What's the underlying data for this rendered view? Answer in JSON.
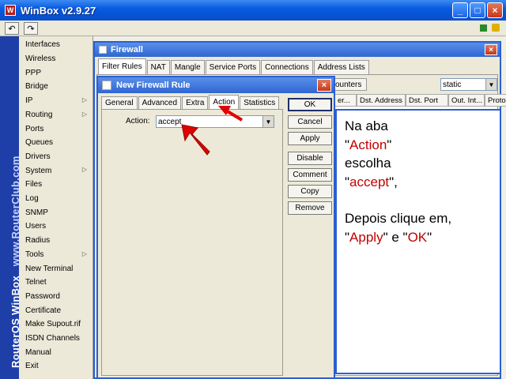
{
  "window": {
    "title": "WinBox v2.9.27",
    "icon_label": "W",
    "minimize": "_",
    "maximize": "□",
    "close": "×"
  },
  "toolbar": {
    "undo": "↶",
    "redo": "↷"
  },
  "brand": {
    "part1": "RouterOS WinBox",
    "part2": "www.RouterClub.com"
  },
  "menu": {
    "items": [
      {
        "label": "Interfaces",
        "arrow": ""
      },
      {
        "label": "Wireless",
        "arrow": ""
      },
      {
        "label": "PPP",
        "arrow": ""
      },
      {
        "label": "Bridge",
        "arrow": ""
      },
      {
        "label": "IP",
        "arrow": "▷"
      },
      {
        "label": "Routing",
        "arrow": "▷"
      },
      {
        "label": "Ports",
        "arrow": ""
      },
      {
        "label": "Queues",
        "arrow": ""
      },
      {
        "label": "Drivers",
        "arrow": ""
      },
      {
        "label": "System",
        "arrow": "▷"
      },
      {
        "label": "Files",
        "arrow": ""
      },
      {
        "label": "Log",
        "arrow": ""
      },
      {
        "label": "SNMP",
        "arrow": ""
      },
      {
        "label": "Users",
        "arrow": ""
      },
      {
        "label": "Radius",
        "arrow": ""
      },
      {
        "label": "Tools",
        "arrow": "▷"
      },
      {
        "label": "New Terminal",
        "arrow": ""
      },
      {
        "label": "Telnet",
        "arrow": ""
      },
      {
        "label": "Password",
        "arrow": ""
      },
      {
        "label": "Certificate",
        "arrow": ""
      },
      {
        "label": "Make Supout.rif",
        "arrow": ""
      },
      {
        "label": "ISDN Channels",
        "arrow": ""
      },
      {
        "label": "Manual",
        "arrow": ""
      },
      {
        "label": "Exit",
        "arrow": ""
      }
    ]
  },
  "firewall": {
    "title": "Firewall",
    "close": "×",
    "tabs": [
      "Filter Rules",
      "NAT",
      "Mangle",
      "Service Ports",
      "Connections",
      "Address Lists"
    ],
    "counters_button": "ounters",
    "chain_select": "static",
    "columns": [
      "er...",
      "Dst. Address",
      "Dst. Port",
      "Out. Int...",
      "Proto..."
    ]
  },
  "dialog": {
    "title": "New Firewall Rule",
    "close": "×",
    "tabs": [
      "General",
      "Advanced",
      "Extra",
      "Action",
      "Statistics"
    ],
    "action_label": "Action:",
    "action_value": "accept",
    "buttons": [
      "OK",
      "Cancel",
      "Apply",
      "Disable",
      "Comment",
      "Copy",
      "Remove"
    ]
  },
  "note": {
    "l1": "Na aba",
    "l2_q1": "\"",
    "l2_red": "Action",
    "l2_q2": "\"",
    "l3": "escolha",
    "l4_q1": "\"",
    "l4_red": "accept",
    "l4_q2": "\",",
    "l5": "Depois clique em,",
    "l6_q1": "\"",
    "l6_red1": "Apply",
    "l6_mid": "\" e \"",
    "l6_red2": "OK",
    "l6_q2": "\""
  },
  "colors": {
    "accent_red": "#c00000",
    "title_blue": "#2b5fd1",
    "arrow_red": "#e00000"
  }
}
